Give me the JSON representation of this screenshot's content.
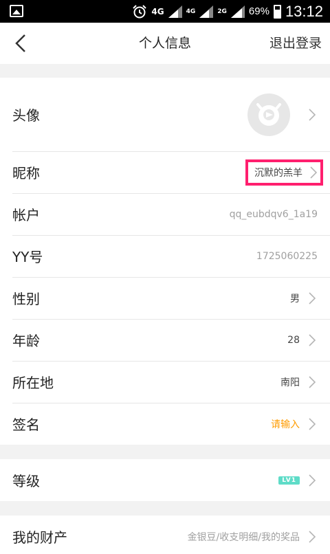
{
  "status_bar": {
    "network_1": "4G",
    "network_2": "4G",
    "network_3": "2G",
    "battery_percent": "69%",
    "time": "13:12"
  },
  "header": {
    "title": "个人信息",
    "logout_label": "退出登录"
  },
  "profile": {
    "avatar_label": "头像",
    "nickname": {
      "label": "昵称",
      "value": "沉默的羔羊"
    },
    "account": {
      "label": "帐户",
      "value": "qq_eubdqv6_1a19"
    },
    "yy_number": {
      "label": "YY号",
      "value": "1725060225"
    },
    "gender": {
      "label": "性别",
      "value": "男"
    },
    "age": {
      "label": "年龄",
      "value": "28"
    },
    "location": {
      "label": "所在地",
      "value": "南阳"
    },
    "signature": {
      "label": "签名",
      "value": "请输入"
    }
  },
  "level": {
    "label": "等级",
    "badge": "LV1"
  },
  "assets": {
    "label": "我的财产",
    "value": "金银豆/收支明细/我的奖品"
  },
  "colors": {
    "highlight_border": "#ff1f6e",
    "signature_hint": "#ff9c00",
    "level_badge": "#5fdcc8"
  }
}
